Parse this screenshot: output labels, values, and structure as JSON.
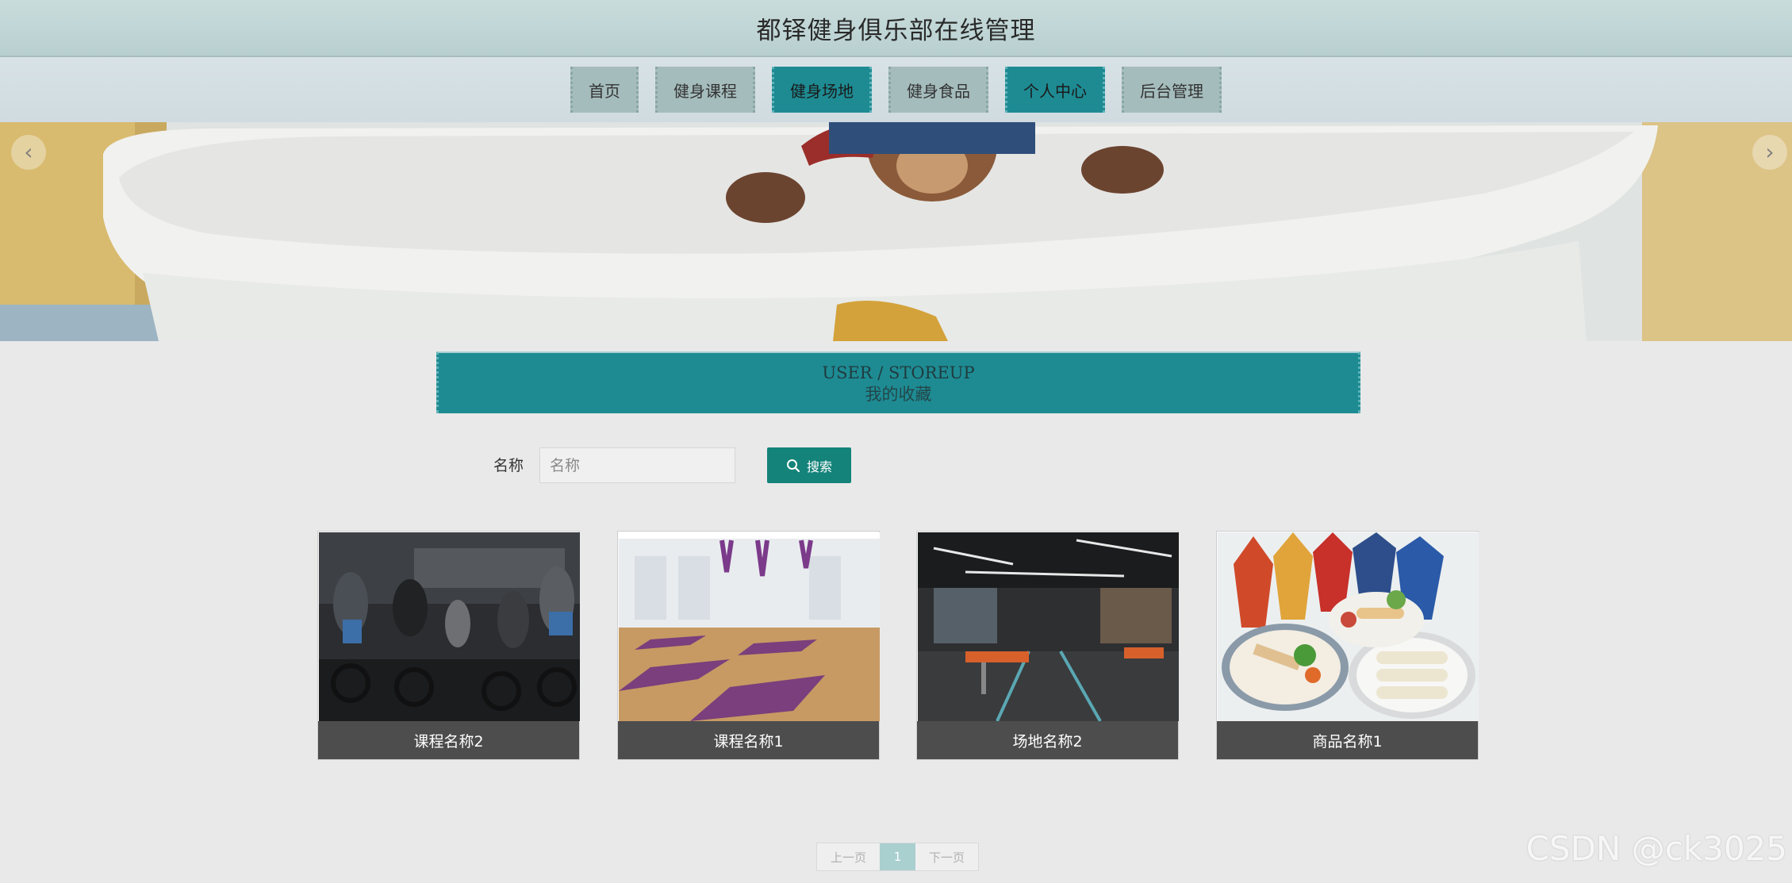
{
  "header": {
    "title": "都铎健身俱乐部在线管理"
  },
  "nav": {
    "items": [
      {
        "label": "首页"
      },
      {
        "label": "健身课程"
      },
      {
        "label": "健身场地"
      },
      {
        "label": "健身食品"
      },
      {
        "label": "个人中心"
      },
      {
        "label": "后台管理"
      }
    ],
    "active": [
      "健身场地",
      "个人中心"
    ]
  },
  "banner": {
    "prev_icon": "chevron-left-icon",
    "next_icon": "chevron-right-icon"
  },
  "section": {
    "title_en": "USER / STOREUP",
    "title_cn": "我的收藏"
  },
  "search": {
    "label": "名称",
    "placeholder": "名称",
    "value": "",
    "button_label": "搜索",
    "button_icon": "search-icon"
  },
  "cards": [
    {
      "caption": "课程名称2"
    },
    {
      "caption": "课程名称1"
    },
    {
      "caption": "场地名称2"
    },
    {
      "caption": "商品名称1"
    }
  ],
  "pagination": {
    "prev": "上一页",
    "current": "1",
    "next": "下一页"
  },
  "watermark": "CSDN @ck3025",
  "colors": {
    "accent": "#1e8b93",
    "button": "#14837a",
    "caption_bg": "#4d4d4d"
  }
}
